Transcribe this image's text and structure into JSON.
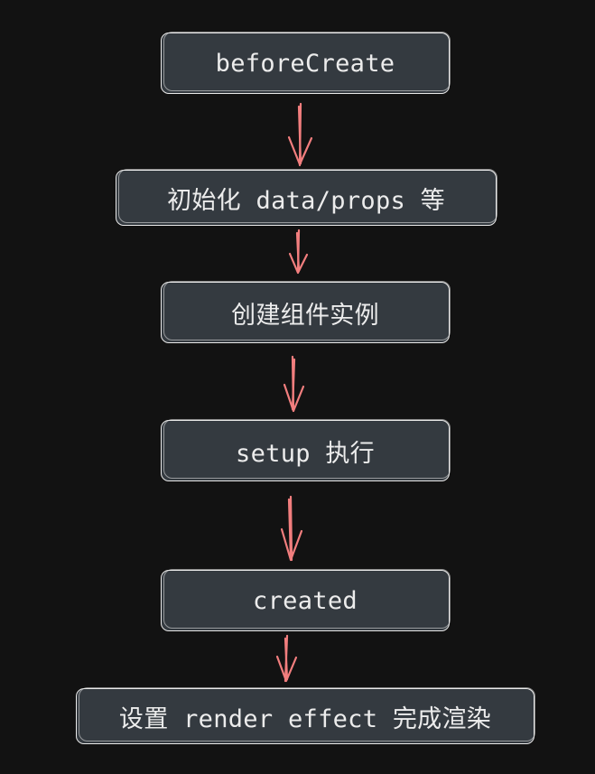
{
  "diagram": {
    "type": "flowchart",
    "direction": "top-to-bottom",
    "colors": {
      "background": "#121212",
      "node_fill": "#343a40",
      "node_border": "#e9e9e9",
      "node_text": "#ececec",
      "arrow": "#f27e7e"
    },
    "nodes": [
      {
        "id": "n1",
        "label": "beforeCreate"
      },
      {
        "id": "n2",
        "label": "初始化 data/props 等"
      },
      {
        "id": "n3",
        "label": "创建组件实例"
      },
      {
        "id": "n4",
        "label": "setup 执行"
      },
      {
        "id": "n5",
        "label": "created"
      },
      {
        "id": "n6",
        "label": "设置 render effect 完成渲染"
      }
    ],
    "edges": [
      {
        "from": "n1",
        "to": "n2"
      },
      {
        "from": "n2",
        "to": "n3"
      },
      {
        "from": "n3",
        "to": "n4"
      },
      {
        "from": "n4",
        "to": "n5"
      },
      {
        "from": "n5",
        "to": "n6"
      }
    ]
  }
}
